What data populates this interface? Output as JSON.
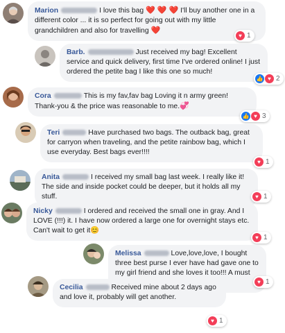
{
  "comments": [
    {
      "name": "Marion",
      "blurred_surname": "Carnovale",
      "text": "I love this bag",
      "text2": "I'll buy another one in a different color ... it is so perfect for going out with my little grandchildren and also for travelling",
      "hearts": "❤️ ❤️ ❤️",
      "end_heart": "❤️",
      "reaction_count": "1",
      "reactions": [
        "heart-icon"
      ]
    },
    {
      "name": "Barb.",
      "blurred_surname": "Gibson Vidnes",
      "text": "Just received my bag! Excellent service and quick delivery, first time I've ordered online! I just ordered the petite bag I like this one so much!",
      "reaction_count": "2",
      "reactions": [
        "like-icon",
        "heart-icon"
      ]
    },
    {
      "name": "Cora",
      "blurred_surname": "Wilson",
      "text": "This is my fav,fav bag Loving it n army green! Thank-you & the price was reasonable to me.",
      "end_emoji": "💞",
      "reaction_count": "3",
      "reactions": [
        "like-icon",
        "heart-icon"
      ]
    },
    {
      "name": "Teri",
      "blurred_surname": "Kosel",
      "text": "Have purchased two bags. The outback bag, great for carryon when traveling, and the petite rainbow bag, which I use everyday. Best bags ever!!!!",
      "reaction_count": "1",
      "reactions": [
        "heart-icon"
      ]
    },
    {
      "name": "Anita",
      "blurred_surname": "Dube",
      "text": "I received my small bag last week. I really like it! The side and inside pocket could be deeper, but it holds all my stuff.",
      "reaction_count": "1",
      "reactions": [
        "heart-icon"
      ]
    },
    {
      "name": "Nicky",
      "blurred_surname": "Bryce",
      "text": "I ordered and received the small one in gray. And I LOVE (!!!) it. I have now ordered a large one for overnight stays etc. Can't wait to get it",
      "end_emoji": "😊",
      "reaction_count": "1",
      "reactions": [
        "heart-icon"
      ]
    },
    {
      "name": "Melissa",
      "blurred_surname": "Pannell",
      "text": "Love,love,love, I bought three best purse I ever have had gave one to my girl friend and she loves it too!!! A must buy",
      "reaction_count": "1",
      "reactions": [
        "heart-icon"
      ]
    },
    {
      "name": "Cecilia",
      "blurred_surname": "Garcia",
      "text": "Received mine about 2 days ago and love it, probably will get another.",
      "reaction_count": "1",
      "reactions": [
        "heart-icon"
      ]
    }
  ],
  "colors": {
    "name": "#385898",
    "bubble": "#f2f3f5",
    "heart_react": "#f33e58",
    "like_react": "#1877f2"
  }
}
